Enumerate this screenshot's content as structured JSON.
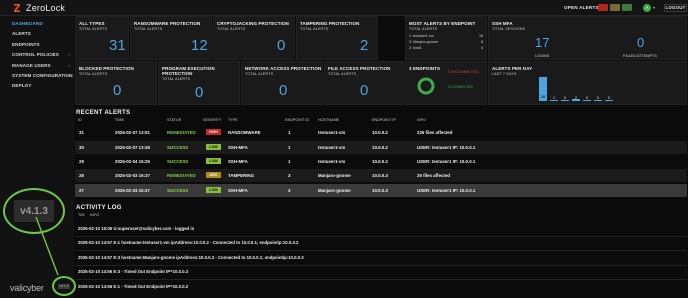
{
  "app": {
    "title": "ZeroLock",
    "brand": "valicyber"
  },
  "topbar": {
    "open_alerts_label": "OPEN ALERTS",
    "user_initial": "A",
    "logout_label": "LOGOUT"
  },
  "sidebar": {
    "items": [
      {
        "label": "DASHBOARD",
        "active": true,
        "has_submenu": false
      },
      {
        "label": "ALERTS",
        "active": false,
        "has_submenu": false
      },
      {
        "label": "ENDPOINTS",
        "active": false,
        "has_submenu": false
      },
      {
        "label": "CONTROL POLICIES",
        "active": false,
        "has_submenu": true
      },
      {
        "label": "MANAGE USERS",
        "active": false,
        "has_submenu": true
      },
      {
        "label": "SYSTEM CONFIGURATION",
        "active": false,
        "has_submenu": true
      },
      {
        "label": "DEPLOY",
        "active": false,
        "has_submenu": false
      }
    ],
    "version": "v4.1.3",
    "small_version": "v4.1.3",
    "caret_glyph": "›"
  },
  "cards": {
    "all_types": {
      "title": "ALL TYPES",
      "sub": "TOTAL ALERTS",
      "value": "31"
    },
    "ransomware": {
      "title": "RANSOMWARE PROTECTION",
      "sub": "TOTAL ALERTS",
      "value": "12"
    },
    "cryptojacking": {
      "title": "CRYPTOJACKING PROTECTION",
      "sub": "TOTAL ALERTS",
      "value": "0"
    },
    "tampering": {
      "title": "TAMPERING PROTECTION",
      "sub": "TOTAL ALERTS",
      "value": "2"
    },
    "most_alerts": {
      "title": "MOST ALERTS BY ENDPOINT",
      "sub": "TOTAL ALERTS",
      "items": [
        {
          "name": "1: testuser1-vm",
          "count": "16"
        },
        {
          "name": "3: Manjaro-gnome",
          "count": "8"
        },
        {
          "name": "2: host1",
          "count": "4"
        }
      ]
    },
    "ssh_mfa": {
      "title": "SSH MFA",
      "sub": "TOTAL SESSIONS",
      "logins_value": "17",
      "logins_label": "LOGINS",
      "failed_value": "0",
      "failed_label": "FAILED ATTEMPTS"
    },
    "blocked": {
      "title": "BLOCKED PROTECTION",
      "sub": "TOTAL ALERTS",
      "value": "0"
    },
    "program_exec": {
      "title": "PROGRAM EXECUTION PROTECTION",
      "sub": "TOTAL ALERTS",
      "value": "0"
    },
    "network_access": {
      "title": "NETWORK ACCESS PROTECTION",
      "sub": "TOTAL ALERTS",
      "value": "0"
    },
    "file_access": {
      "title": "FILE ACCESS PROTECTION",
      "sub": "TOTAL ALERTS",
      "value": "0"
    },
    "endpoints": {
      "title": "3 ENDPOINTS",
      "disconnected_label": "0 DISCONNECTED",
      "connected_label": "3 CONNECTED",
      "disconnected": 0,
      "connected": 3
    },
    "alerts_per_day": {
      "title": "ALERTS PER DAY",
      "sub": "LAST 7 DAYS"
    }
  },
  "chart_data": {
    "type": "bar",
    "values": [
      26,
      1,
      0,
      2,
      0,
      0,
      0
    ],
    "ylim": [
      0,
      26
    ]
  },
  "recent_alerts": {
    "title": "RECENT ALERTS",
    "headers": [
      "ID",
      "TIME",
      "STATUS",
      "SEVERITY",
      "TYPE",
      "ENDPOINT ID",
      "HOSTNAME",
      "ENDPOINT IP",
      "INFO"
    ],
    "rows": [
      {
        "id": "31",
        "time": "2025-02-07 13:51",
        "status": "REMEDIATED",
        "severity": "HIGH",
        "type": "RANSOMWARE",
        "endpoint_id": "1",
        "hostname": "testuser1-vm",
        "ip": "10.0.0.2",
        "info": "226 files affected"
      },
      {
        "id": "30",
        "time": "2025-02-07 13:48",
        "status": "SUCCESS",
        "severity": "LOW",
        "type": "SSH-MFA",
        "endpoint_id": "1",
        "hostname": "testuser1-vm",
        "ip": "10.0.0.2",
        "info": "USER: testuser1 IP: 10.0.0.1"
      },
      {
        "id": "29",
        "time": "2025-02-04 15:25",
        "status": "SUCCESS",
        "severity": "LOW",
        "type": "SSH-MFA",
        "endpoint_id": "1",
        "hostname": "testuser1-vm",
        "ip": "10.0.0.2",
        "info": "USER: testuser1 IP: 10.0.0.1"
      },
      {
        "id": "28",
        "time": "2025-02-03 16:37",
        "status": "REMEDIATED",
        "severity": "MED",
        "type": "TAMPERING",
        "endpoint_id": "3",
        "hostname": "Manjaro-gnome",
        "ip": "10.0.0.3",
        "info": "25 files affected"
      },
      {
        "id": "27",
        "time": "2025-02-03 16:37",
        "status": "SUCCESS",
        "severity": "LOW",
        "type": "SSH-MFA",
        "endpoint_id": "3",
        "hostname": "Manjaro-gnome",
        "ip": "10.0.0.3",
        "info": "USER: testuser1 IP: 10.0.0.1"
      }
    ]
  },
  "activity_log": {
    "title": "ACTIVITY LOG",
    "headers": [
      "TIM",
      "INFO"
    ],
    "rows": [
      "2025-02-10 15:06  U:superuser@valicyber.com - logged in",
      "2025-02-10 14:57  E:1 hostname:testuser1-vm ipAddress:10.0.0.2 - Connected to 10.0.0.1; endpointip:10.0.0.2",
      "2025-02-10 14:57  E:3 hostname:Manjaro-gnome ipAddress:10.0.0.3 - Connected to 10.0.0.1; endpointip:10.0.0.3",
      "2025-02-10 14:56  E:3 - Timed Out Endpoint IP=10.0.0.3",
      "2025-02-10 14:56  E:1 - Timed Out Endpoint IP=10.0.0.2"
    ]
  },
  "colors": {
    "accent_blue": "#4ea3e0",
    "success_green": "#8fd34d",
    "remediated_green": "#7ac94a",
    "sev_high": "#c62828",
    "sev_low": "#8bbd3c",
    "sev_med": "#b38b1e",
    "highlight_ring": "#6cc84a"
  }
}
